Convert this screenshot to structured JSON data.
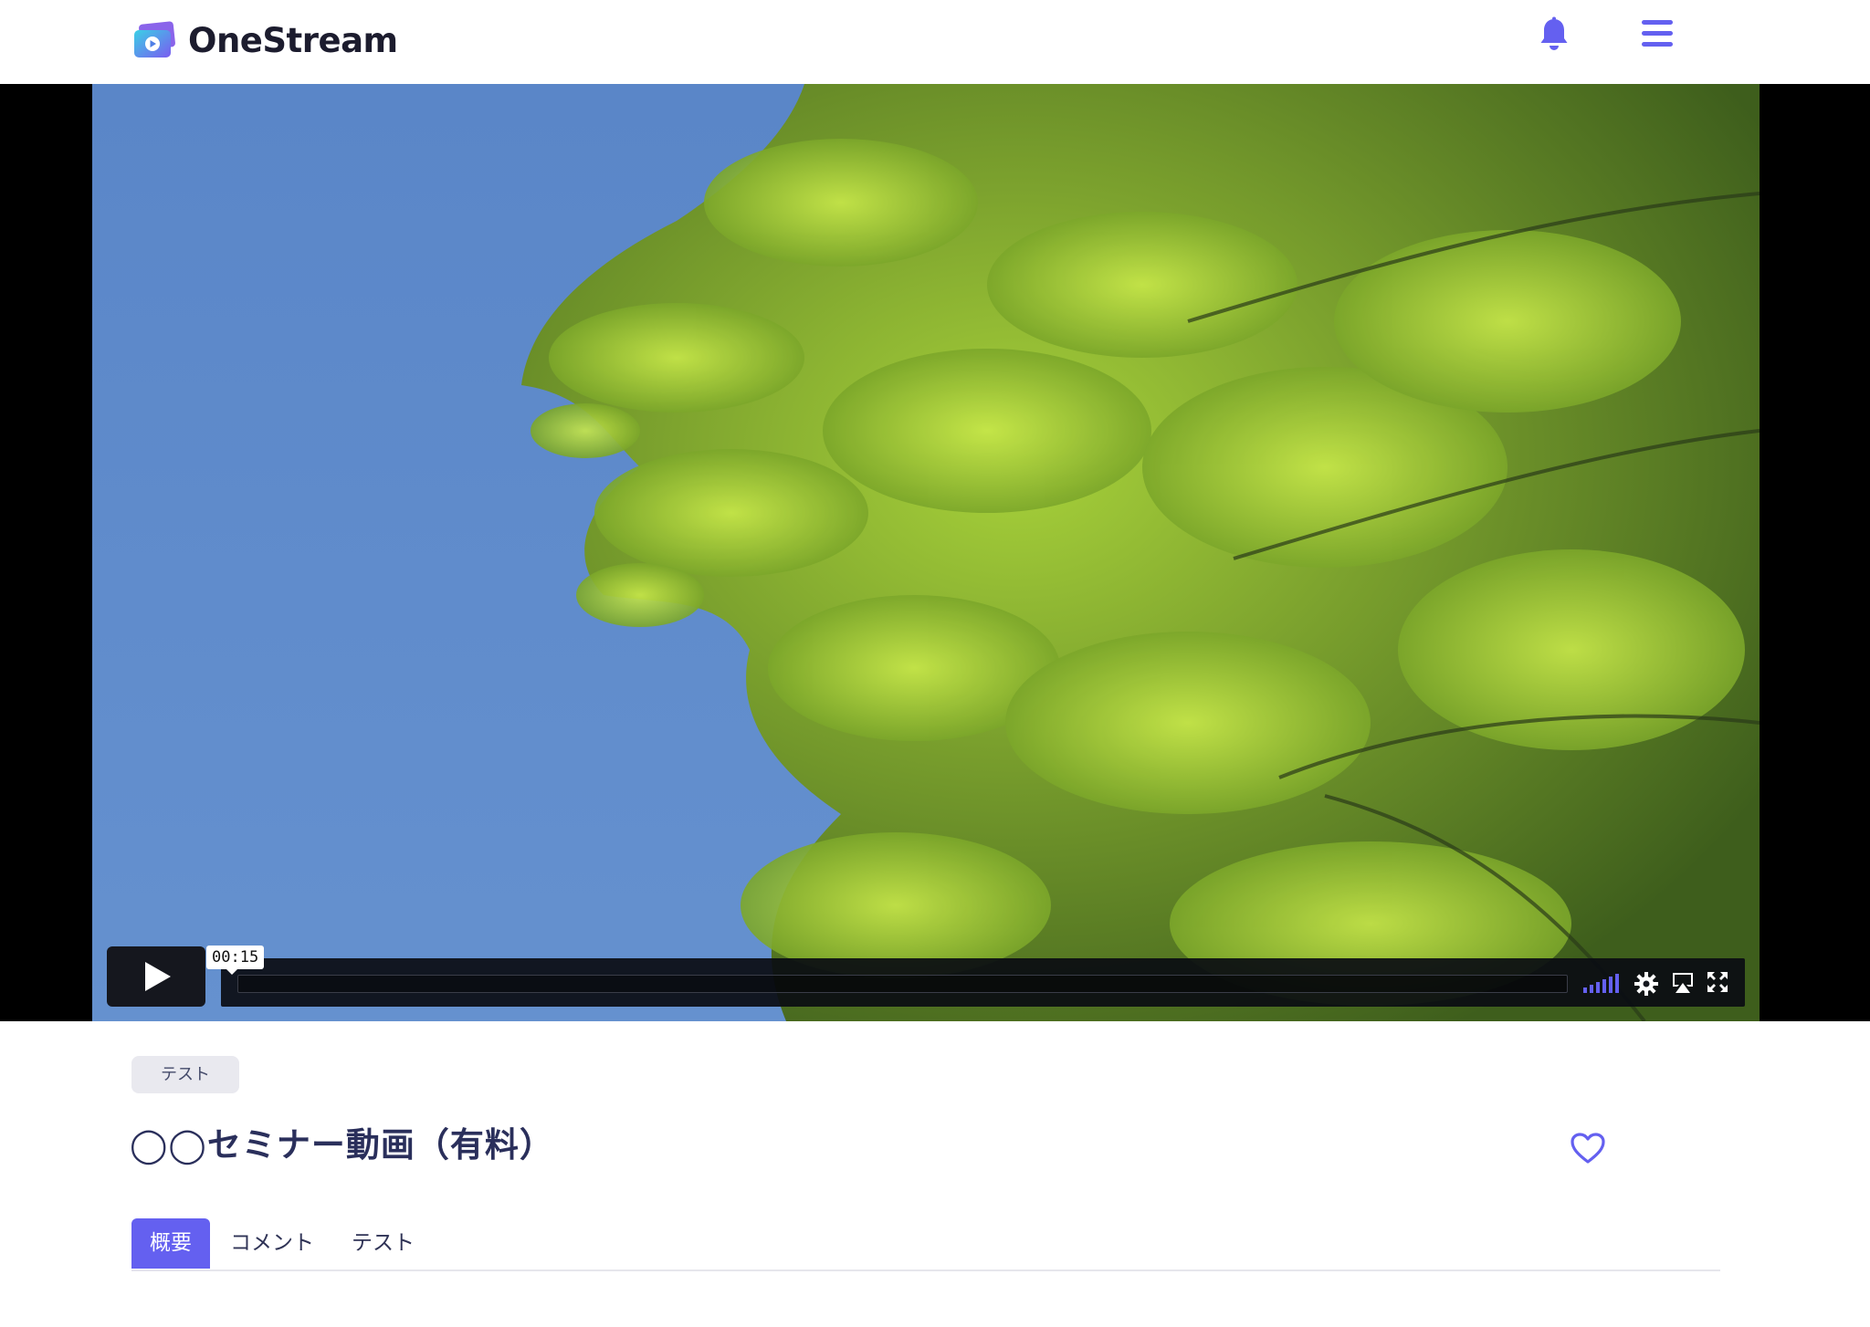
{
  "header": {
    "logo_text": "OneStream",
    "icons": [
      "notification-bell-icon",
      "hamburger-menu-icon"
    ],
    "accent_color": "#6460f0"
  },
  "player": {
    "time_tooltip": "00:15",
    "progress_fraction": 0,
    "controls": [
      "play-icon",
      "volume-icon",
      "settings-gear-icon",
      "airplay-icon",
      "fullscreen-icon"
    ]
  },
  "video_info": {
    "tag": "テスト",
    "title": "◯◯セミナー動画（有料）",
    "favorite_icon": "heart-outline-icon"
  },
  "tabs": [
    {
      "label": "概要",
      "active": true
    },
    {
      "label": "コメント",
      "active": false
    },
    {
      "label": "テスト",
      "active": false
    }
  ]
}
